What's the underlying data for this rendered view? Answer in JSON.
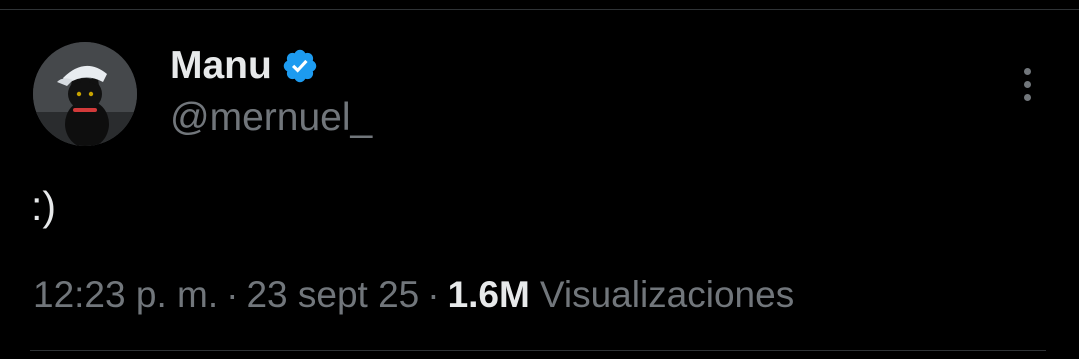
{
  "tweet": {
    "author": {
      "display_name": "Manu",
      "handle": "@mernuel_",
      "verified": true,
      "verified_icon": "verified-badge-icon",
      "verified_color": "#1d9bf0"
    },
    "text": ":)",
    "time": "12:23 p. m.",
    "date": "23 sept 25",
    "separator": "·",
    "views_count": "1.6M",
    "views_label": "Visualizaciones",
    "more_icon": "more-vertical-icon"
  },
  "colors": {
    "background": "#000000",
    "primary_text": "#e7e9ea",
    "secondary_text": "#71767b",
    "divider": "#2f3336",
    "accent": "#1d9bf0"
  }
}
